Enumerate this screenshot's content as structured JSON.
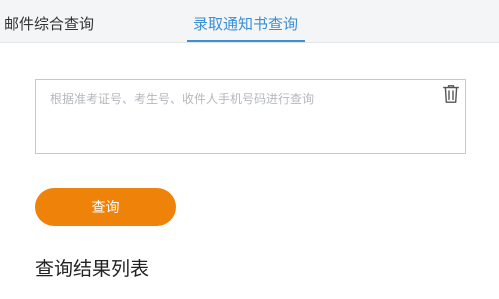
{
  "tabs": {
    "items": [
      {
        "label": "邮件综合查询",
        "active": false
      },
      {
        "label": "录取通知书查询",
        "active": true
      }
    ]
  },
  "query": {
    "placeholder": "根据准考证号、考生号、收件人手机号码进行查询",
    "value": "",
    "clear_icon": "trash-icon"
  },
  "actions": {
    "query_label": "查询"
  },
  "results": {
    "title": "查询结果列表"
  },
  "colors": {
    "accent": "#3a8fd6",
    "button": "#ef8208",
    "tabbar_bg": "#f4f5f7"
  }
}
